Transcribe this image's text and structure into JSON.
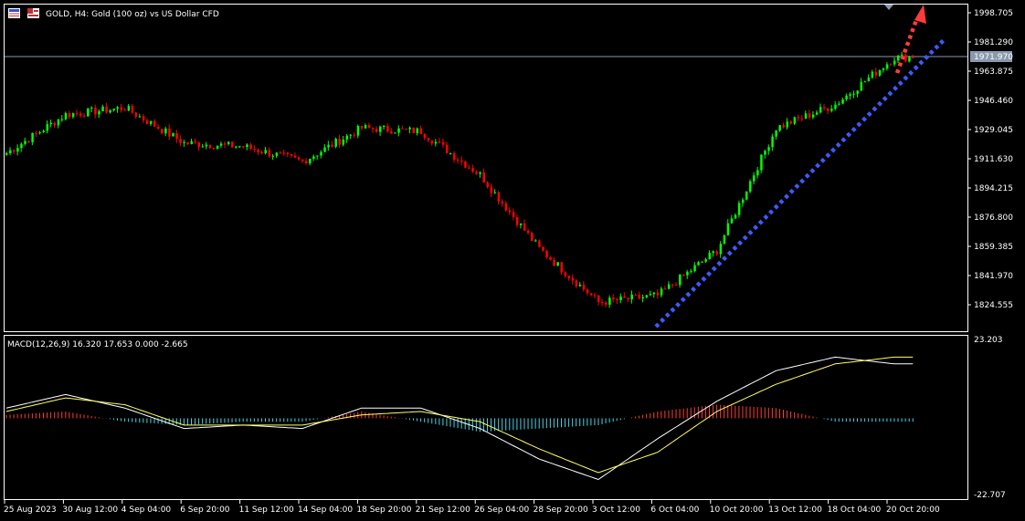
{
  "window": {
    "title": "GOLD, H4:  Gold (100 oz) vs US Dollar CFD",
    "icons": [
      "chart-window-icon",
      "market-flag-icon"
    ]
  },
  "colors": {
    "background": "#000000",
    "bull_candle": "#00ff00",
    "bear_candle": "#ff0000",
    "macd_hist_positive": "#ff3b3b",
    "macd_hist_negative": "#4ad4e6",
    "macd_main_line": "#ffffff",
    "macd_signal_line": "#ffff66",
    "trend_arrow": "#ff3b3b",
    "support_line": "#3b5bff",
    "price_line": "#8a9aac",
    "axis": "#ffffff"
  },
  "price_panel": {
    "y_ticks": [
      "1998.705",
      "1981.290",
      "1963.875",
      "1946.460",
      "1929.045",
      "1911.630",
      "1894.215",
      "1876.800",
      "1859.385",
      "1841.970",
      "1824.555"
    ],
    "current_price": "1971.970",
    "ylim": [
      1815.8,
      2002.4
    ]
  },
  "macd_panel": {
    "label": "MACD(12,26,9) 16.320 17.653 0.000 -2.665",
    "y_top": "23.203",
    "y_bottom": "-22.707"
  },
  "x_axis": {
    "labels": [
      "25 Aug 2023",
      "30 Aug 12:00",
      "4 Sep 04:00",
      "6 Sep 20:00",
      "11 Sep 12:00",
      "14 Sep 04:00",
      "18 Sep 20:00",
      "21 Sep 12:00",
      "26 Sep 04:00",
      "28 Sep 20:00",
      "3 Oct 12:00",
      "6 Oct 04:00",
      "10 Oct 20:00",
      "13 Oct 12:00",
      "18 Oct 04:00",
      "20 Oct 20:00"
    ]
  },
  "chart_data": {
    "type": "candlestick",
    "symbol": "GOLD",
    "timeframe": "H4",
    "categories": [
      "25 Aug 2023",
      "30 Aug 12:00",
      "4 Sep 04:00",
      "6 Sep 20:00",
      "11 Sep 12:00",
      "14 Sep 04:00",
      "18 Sep 20:00",
      "21 Sep 12:00",
      "26 Sep 04:00",
      "28 Sep 20:00",
      "3 Oct 12:00",
      "6 Oct 04:00",
      "10 Oct 20:00",
      "13 Oct 12:00",
      "18 Oct 04:00",
      "20 Oct 20:00"
    ],
    "approx_close": [
      1915,
      1938,
      1942,
      1921,
      1919,
      1910,
      1930,
      1928,
      1902,
      1858,
      1826,
      1830,
      1857,
      1930,
      1944,
      1972
    ],
    "ylim": [
      1815.8,
      2002.4
    ],
    "current_price": 1971.97,
    "macd": {
      "params": "12,26,9",
      "main": 16.32,
      "signal": 17.653,
      "ylim": [
        -22.707,
        23.203
      ],
      "approx_histogram": [
        1,
        2,
        -1,
        -2,
        -1,
        -1,
        2,
        -1,
        -4,
        -3,
        -2,
        2,
        4,
        3,
        -1,
        -1
      ],
      "approx_main": [
        3,
        7,
        3,
        -3,
        -2,
        -3,
        3,
        3,
        -3,
        -12,
        -18,
        -6,
        5,
        14,
        18,
        16
      ],
      "approx_signal": [
        2,
        6,
        4,
        -2,
        -2,
        -2,
        1,
        2,
        -1,
        -9,
        -16,
        -10,
        2,
        10,
        16,
        18
      ]
    }
  }
}
